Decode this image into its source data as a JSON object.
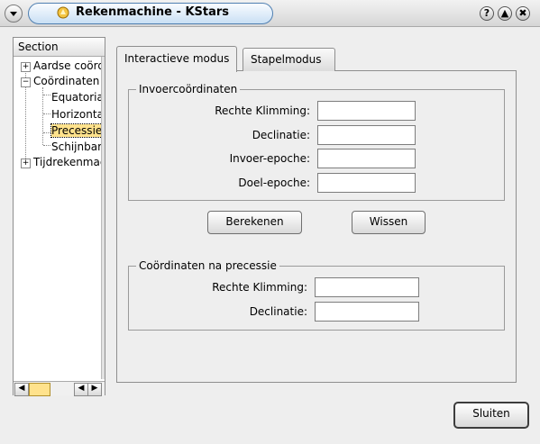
{
  "window": {
    "title": "Rekenmachine - KStars",
    "buttons": {
      "help": "?",
      "maximize": "▲",
      "close": "✖"
    }
  },
  "tree": {
    "header": "Section",
    "items": [
      {
        "label": "Aardse coördinaten",
        "expander": "+"
      },
      {
        "label": "Coördinaten",
        "expander": "−"
      },
      {
        "label": "Equatoriaal/Galactisch"
      },
      {
        "label": "Horizontaal"
      },
      {
        "label": "Precessie"
      },
      {
        "label": "Schijnbare coördinaten"
      },
      {
        "label": "Tijdrekenmachine",
        "expander": "+"
      }
    ],
    "selected_index": 4
  },
  "tabs": [
    {
      "label": "Interactieve modus",
      "active": true
    },
    {
      "label": "Stapelmodus",
      "active": false
    }
  ],
  "input_group": {
    "title": "Invoercoördinaten",
    "fields": [
      {
        "label": "Rechte Klimming:",
        "value": ""
      },
      {
        "label": "Declinatie:",
        "value": ""
      },
      {
        "label": "Invoer-epoche:",
        "value": ""
      },
      {
        "label": "Doel-epoche:",
        "value": ""
      }
    ]
  },
  "actions": {
    "compute": "Berekenen",
    "clear": "Wissen"
  },
  "output_group": {
    "title": "Coördinaten na precessie",
    "fields": [
      {
        "label": "Rechte Klimming:",
        "value": ""
      },
      {
        "label": "Declinatie:",
        "value": ""
      }
    ]
  },
  "footer": {
    "close": "Sluiten"
  },
  "colors": {
    "selection": "#ffe28c",
    "title_pill": "#c9dff4",
    "background": "#eeeeee"
  },
  "icons": [
    "window-menu-icon",
    "kstars-app-icon",
    "help-icon",
    "maximize-icon",
    "close-icon",
    "arrow-left-icon",
    "arrow-right-icon"
  ]
}
